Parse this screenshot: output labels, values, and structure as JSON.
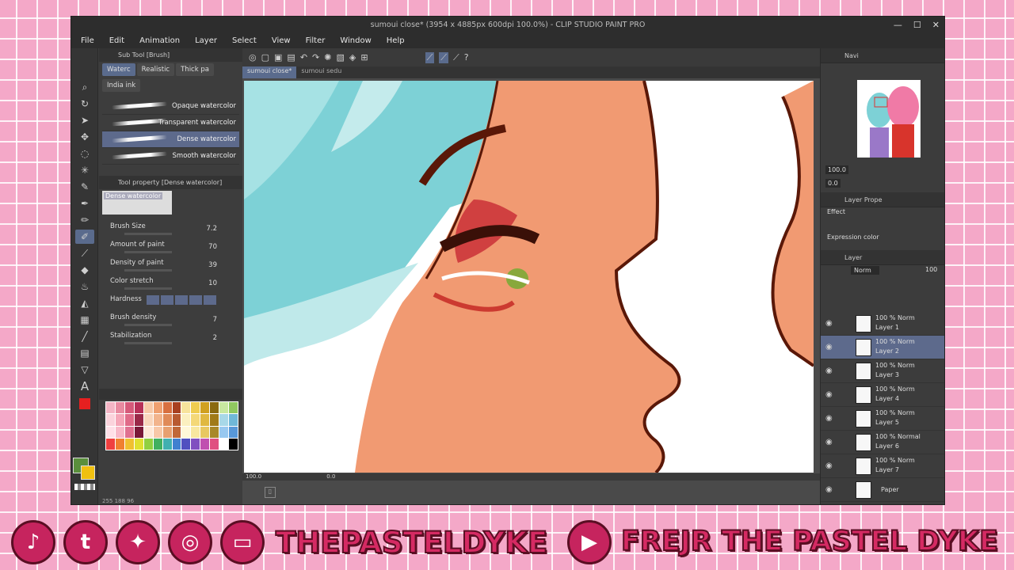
{
  "app": {
    "title": "sumoui close* (3954 x 4885px 600dpi 100.0%) - CLIP STUDIO PAINT PRO",
    "menu": [
      "File",
      "Edit",
      "Animation",
      "Layer",
      "Select",
      "View",
      "Filter",
      "Window",
      "Help"
    ]
  },
  "subtool": {
    "panel_title": "Sub Tool [Brush]",
    "tabs": [
      "Waterc",
      "Realistic",
      "Thick pa"
    ],
    "tab2": "India ink",
    "brushes": [
      "Opaque watercolor",
      "Transparent watercolor",
      "Dense watercolor",
      "Smooth watercolor"
    ]
  },
  "toolprop": {
    "panel_title": "Tool property [Dense watercolor]",
    "preset_name": "Dense watercolor",
    "props": [
      {
        "label": "Brush Size",
        "value": "7.2"
      },
      {
        "label": "Amount of paint",
        "value": "70"
      },
      {
        "label": "Density of paint",
        "value": "39"
      },
      {
        "label": "Color stretch",
        "value": "10"
      },
      {
        "label": "Hardness",
        "value": ""
      },
      {
        "label": "Brush density",
        "value": "7"
      },
      {
        "label": "Stabilization",
        "value": "2"
      }
    ]
  },
  "colors": {
    "readout": "255  188  96",
    "main": "#5a8f3c",
    "sub": "#f0c010",
    "accent": "#5a6b8d"
  },
  "canvas": {
    "tabs": [
      "sumoui close*",
      "sumoui sedu"
    ],
    "zoom": "100.0",
    "angle": "0.0"
  },
  "navigator": {
    "title": "Navi",
    "zoom": "100.0",
    "angle": "0.0"
  },
  "layerprop": {
    "title": "Layer Prope",
    "effect": "Effect",
    "expression": "Expression color"
  },
  "layers_panel": {
    "title": "Layer",
    "blend": "Norm",
    "opacity": "100",
    "items": [
      {
        "blend": "100 % Norm",
        "name": "Layer 1",
        "selected": false
      },
      {
        "blend": "100 % Norm",
        "name": "Layer 2",
        "selected": true
      },
      {
        "blend": "100 % Norm",
        "name": "Layer 3",
        "selected": false
      },
      {
        "blend": "100 % Norm",
        "name": "Layer 4",
        "selected": false
      },
      {
        "blend": "100 % Norm",
        "name": "Layer 5",
        "selected": false
      },
      {
        "blend": "100 % Normal",
        "name": "Layer 6",
        "selected": false
      },
      {
        "blend": "100 % Norm",
        "name": "Layer 7",
        "selected": false
      },
      {
        "blend": "",
        "name": "Paper",
        "selected": false
      }
    ]
  },
  "social": {
    "icons": [
      "tiktok-icon",
      "tumblr-icon",
      "twitter-icon",
      "instagram-icon",
      "twitch-icon",
      "youtube-icon"
    ],
    "handle": "THEPASTELDYKE",
    "youtube_name": "FREJR THE PASTEL DYKE"
  }
}
